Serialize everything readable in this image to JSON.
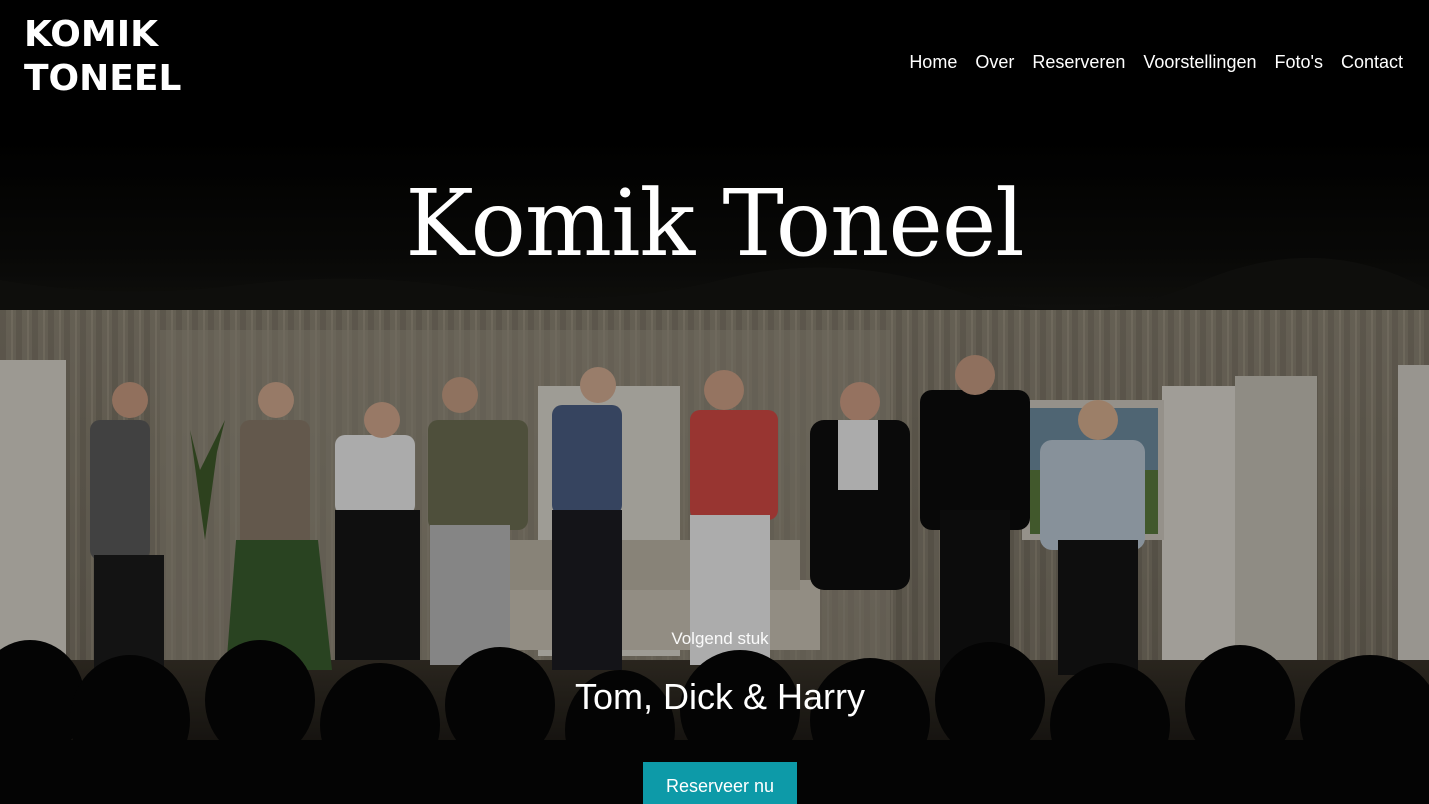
{
  "site": {
    "logo_text_line1": "KOMIK",
    "logo_text_line2": "TONEEL"
  },
  "nav": {
    "items": [
      "Home",
      "Over",
      "Reserveren",
      "Voorstellingen",
      "Foto's",
      "Contact"
    ]
  },
  "hero": {
    "title": "Komik Toneel",
    "next_label": "Volgend stuk",
    "next_title": "Tom, Dick & Harry",
    "cta_label": "Reserveer nu"
  },
  "colors": {
    "accent": "#0d9aa8",
    "background": "#000000",
    "text": "#ffffff"
  }
}
